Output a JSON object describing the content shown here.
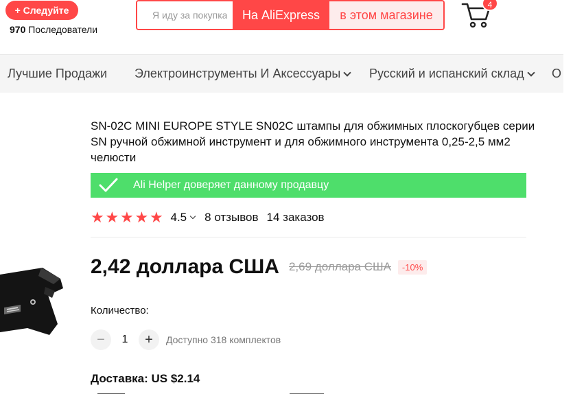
{
  "store": {
    "follow_label": "+ Следуйте",
    "followers_count": "970",
    "followers_label": "Последователи"
  },
  "search": {
    "placeholder": "Я иду за покупками",
    "on_aliexpress_label": "На AliExpress",
    "in_store_label": "в этом магазине"
  },
  "cart": {
    "count": "4",
    "icon": "cart-icon"
  },
  "nav": {
    "items": [
      {
        "label": "Лучшие Продажи",
        "has_dropdown": false
      },
      {
        "label": "Электроинструменты И Аксессуары",
        "has_dropdown": true
      },
      {
        "label": "Русский и испанский склад",
        "has_dropdown": true
      },
      {
        "label": "О",
        "has_dropdown": false
      }
    ]
  },
  "product": {
    "title": "SN-02C MINI EUROPE STYLE SN02C штампы для обжимных плоскогубцев серии SN ручной обжимной инструмент и для обжимного инструмента 0,25-2,5 мм2 челюсти",
    "trust_text": "Ali Helper доверяет данному продавцу",
    "rating": {
      "stars": 5,
      "value": "4.5",
      "reviews": "8 отзывов",
      "orders": "14 заказов"
    },
    "price": {
      "current": "2,42 доллара США",
      "old": "2,69 доллара США",
      "discount": "-10%"
    },
    "quantity": {
      "label": "Количество:",
      "value": "1",
      "available": "Доступно 318 комплектов"
    },
    "shipping": {
      "label": "Доставка: US $2.14"
    }
  },
  "colors": {
    "accent": "#ff4747",
    "trust_green": "#4ede6b",
    "nav_bg": "#f5f5f5"
  }
}
